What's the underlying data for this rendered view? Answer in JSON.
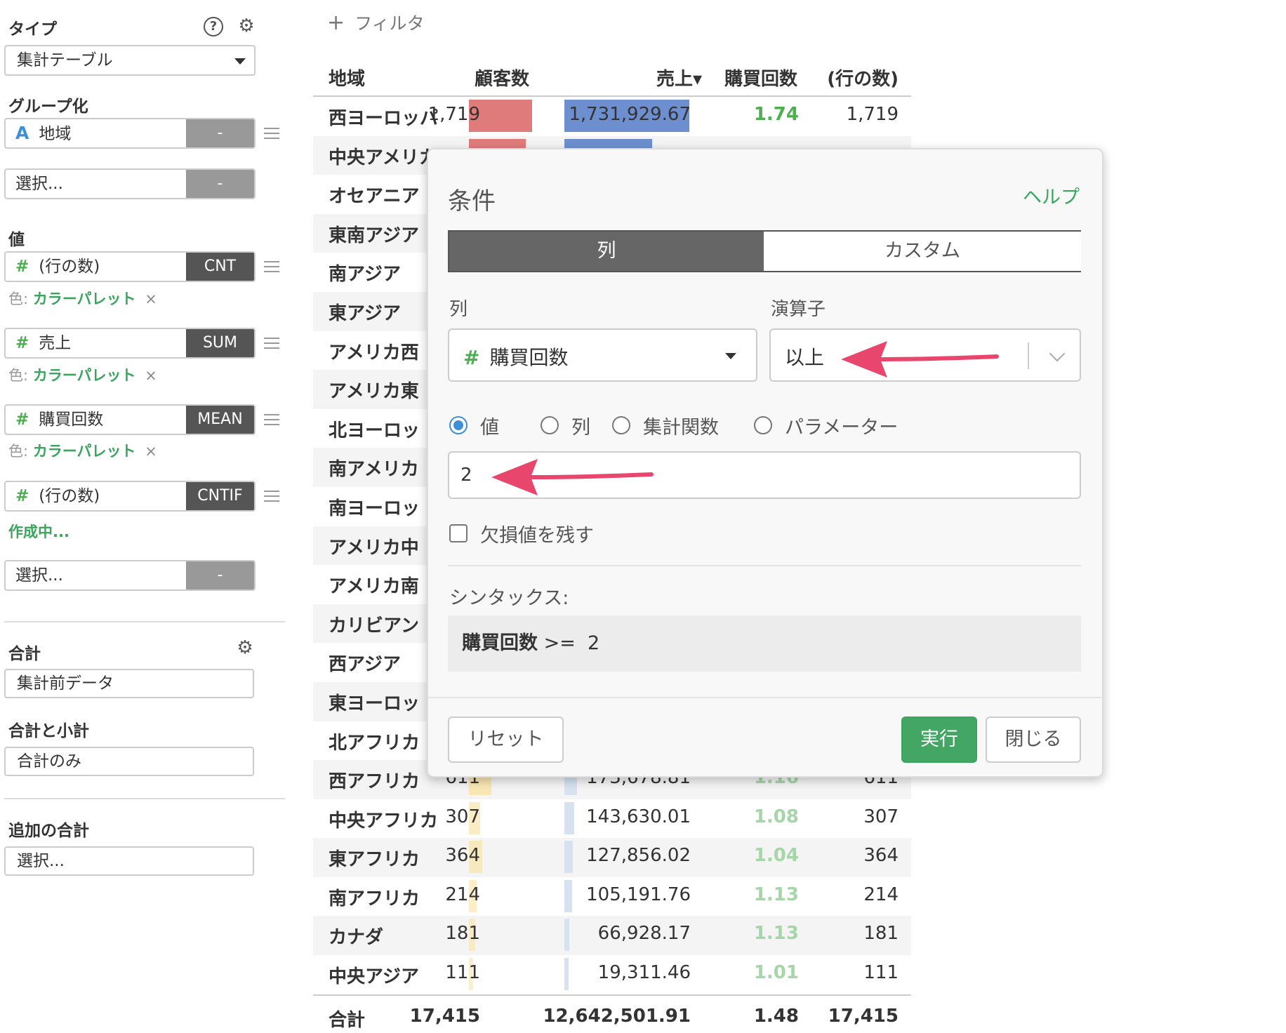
{
  "sidebar": {
    "type_heading": "タイプ",
    "type_value": "集計テーブル",
    "grouping_heading": "グループ化",
    "group_field": "地域",
    "group_field_agg": "-",
    "group_select_placeholder": "選択...",
    "group_select_agg": "-",
    "values_heading": "値",
    "values": [
      {
        "label": "(行の数)",
        "agg": "CNT",
        "color_prefix": "色:",
        "color_value": "カラーパレット",
        "remove": "×"
      },
      {
        "label": "売上",
        "agg": "SUM",
        "color_prefix": "色:",
        "color_value": "カラーパレット",
        "remove": "×"
      },
      {
        "label": "購買回数",
        "agg": "MEAN",
        "color_prefix": "色:",
        "color_value": "カラーパレット",
        "remove": "×"
      },
      {
        "label": "(行の数)",
        "agg": "CNTIF",
        "status": "作成中..."
      }
    ],
    "value_select_placeholder": "選択...",
    "value_select_agg": "-",
    "total_heading": "合計",
    "total_value": "集計前データ",
    "subtotal_heading": "合計と小計",
    "subtotal_value": "合計のみ",
    "extra_total_heading": "追加の合計",
    "extra_total_placeholder": "選択..."
  },
  "filter": {
    "plus": "+",
    "label": "フィルタ"
  },
  "table": {
    "headers": {
      "region": "地域",
      "customers": "顧客数",
      "sales": "売上▾",
      "purchases": "購買回数",
      "rows": "(行の数)"
    },
    "rows": [
      {
        "region": "西ヨーロッパ",
        "customers": "1,719",
        "sales": "1,731,929.67",
        "purchases": "1.74",
        "rows": "1,719",
        "cust_frac": 1.0,
        "sales_frac": 1.0
      },
      {
        "region": "中央アメリカ",
        "customers": "",
        "sales": "",
        "purchases": "",
        "rows": "",
        "cust_frac": 0.9,
        "sales_frac": 0.7
      },
      {
        "region": "オセアニア",
        "customers": "",
        "sales": "",
        "purchases": "",
        "rows": ""
      },
      {
        "region": "東南アジア",
        "customers": "",
        "sales": "",
        "purchases": "",
        "rows": ""
      },
      {
        "region": "南アジア",
        "customers": "",
        "sales": "",
        "purchases": "",
        "rows": ""
      },
      {
        "region": "東アジア",
        "customers": "",
        "sales": "",
        "purchases": "",
        "rows": ""
      },
      {
        "region": "アメリカ西",
        "customers": "",
        "sales": "",
        "purchases": "",
        "rows": ""
      },
      {
        "region": "アメリカ東",
        "customers": "",
        "sales": "",
        "purchases": "",
        "rows": ""
      },
      {
        "region": "北ヨーロッ",
        "customers": "",
        "sales": "",
        "purchases": "",
        "rows": ""
      },
      {
        "region": "南アメリカ",
        "customers": "",
        "sales": "",
        "purchases": "",
        "rows": ""
      },
      {
        "region": "南ヨーロッ",
        "customers": "",
        "sales": "",
        "purchases": "",
        "rows": ""
      },
      {
        "region": "アメリカ中",
        "customers": "",
        "sales": "",
        "purchases": "",
        "rows": ""
      },
      {
        "region": "アメリカ南",
        "customers": "",
        "sales": "",
        "purchases": "",
        "rows": ""
      },
      {
        "region": "カリビアン",
        "customers": "",
        "sales": "",
        "purchases": "",
        "rows": ""
      },
      {
        "region": "西アジア",
        "customers": "",
        "sales": "",
        "purchases": "",
        "rows": ""
      },
      {
        "region": "東ヨーロッ",
        "customers": "",
        "sales": "",
        "purchases": "",
        "rows": ""
      },
      {
        "region": "北アフリカ",
        "customers": "",
        "sales": "",
        "purchases": "",
        "rows": ""
      },
      {
        "region": "西アフリカ",
        "customers": "611",
        "sales": "173,678.81",
        "purchases": "1.16",
        "rows": "611",
        "cust_frac": 0.36,
        "sales_frac": 0.1
      },
      {
        "region": "中央アフリカ",
        "customers": "307",
        "sales": "143,630.01",
        "purchases": "1.08",
        "rows": "307",
        "cust_frac": 0.18,
        "sales_frac": 0.08
      },
      {
        "region": "東アフリカ",
        "customers": "364",
        "sales": "127,856.02",
        "purchases": "1.04",
        "rows": "364",
        "cust_frac": 0.21,
        "sales_frac": 0.07
      },
      {
        "region": "南アフリカ",
        "customers": "214",
        "sales": "105,191.76",
        "purchases": "1.13",
        "rows": "214",
        "cust_frac": 0.12,
        "sales_frac": 0.06
      },
      {
        "region": "カナダ",
        "customers": "181",
        "sales": "66,928.17",
        "purchases": "1.13",
        "rows": "181",
        "cust_frac": 0.1,
        "sales_frac": 0.04
      },
      {
        "region": "中央アジア",
        "customers": "111",
        "sales": "19,311.46",
        "purchases": "1.01",
        "rows": "111",
        "cust_frac": 0.06,
        "sales_frac": 0.01
      }
    ],
    "total": {
      "region": "合計",
      "customers": "17,415",
      "sales": "12,642,501.91",
      "purchases": "1.48",
      "rows": "17,415"
    }
  },
  "dialog": {
    "title": "条件",
    "help": "ヘルプ",
    "tab_column": "列",
    "tab_custom": "カスタム",
    "column_label": "列",
    "operator_label": "演算子",
    "column_value": "購買回数",
    "operator_value": "以上",
    "radio_value": "値",
    "radio_column": "列",
    "radio_aggfunc": "集計関数",
    "radio_param": "パラメーター",
    "input_value": "2",
    "keep_na_label": "欠損値を残す",
    "syntax_label": "シンタックス:",
    "syntax_column": "購買回数",
    "syntax_rest": " >=  2",
    "reset": "リセット",
    "run": "実行",
    "close": "閉じる"
  },
  "colors": {
    "accent_green": "#43a665",
    "customers_bar": "#e07b7b",
    "sales_bar": "#6d8fcf",
    "arrow": "#e8466d"
  }
}
